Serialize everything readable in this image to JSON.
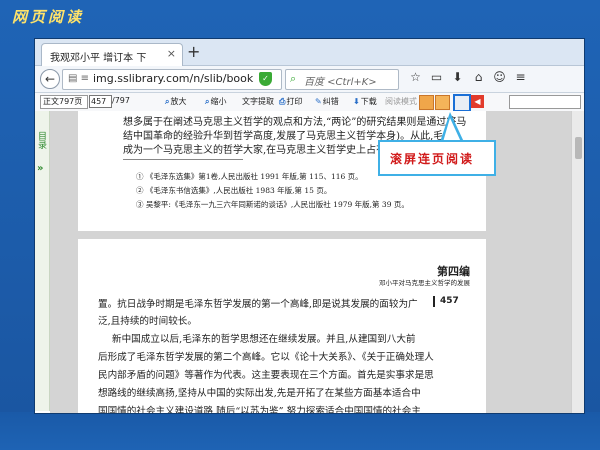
{
  "slide": {
    "title": "网页阅读",
    "colors": {
      "background": "#1f64b6",
      "title": "#ffe36a"
    }
  },
  "browser": {
    "tab_title": "我观邓小平 增订本 下",
    "tab_close_icon": "close-icon",
    "new_tab_icon": "plus-icon",
    "url": "img.sslibrary.com/n/slib/book",
    "search_placeholder": "百度 <Ctrl+K>",
    "nav_icons": [
      "star-icon",
      "reading-list-icon",
      "download-icon",
      "home-icon",
      "chat-icon",
      "menu-icon"
    ]
  },
  "reader_toolbar": {
    "page_select": "正文797页",
    "page_input": "457",
    "page_total": "/797",
    "zoom_in": "放大",
    "zoom_out": "缩小",
    "text_extract": "文字提取",
    "print": "打印",
    "correct": "纠错",
    "download": "下载",
    "reading_mode": "阅读模式"
  },
  "sidebar": {
    "tab_label": "目录",
    "expand_icon": "double-chevron-right-icon"
  },
  "page_prev": {
    "lines": [
      "想多属于在阐述马克思主义哲学的观点和方法,“两论”的研究结果则是通过将马",
      "结中国革命的经验升华到哲学高度,发展了马克思主义哲学本身)。从此,毛泽",
      "成为一个马克思主义的哲学大家,在马克思主义哲学史上占有一席之地。"
    ],
    "footnotes": [
      "①  《毛泽东选集》第1卷,人民出版社 1991 年版,第 115、116 页。",
      "②  《毛泽东书信选集》,人民出版社 1983 年版,第 15 页。",
      "③  吴黎平:《毛泽东一九三六年同斯诺的谈话》,人民出版社 1979 年版,第 39 页。"
    ]
  },
  "page_current": {
    "chapter_title": "第四编",
    "chapter_subtitle": "邓小平对马克思主义哲学的发展",
    "page_number": "457",
    "lines": [
      "置。抗日战争时期是毛泽东哲学发展的第一个高峰,即是说其发展的面较为广",
      "泛,且持续的时间较长。",
      "新中国成立以后,毛泽东的哲学思想还在继续发展。并且,从建国到八大前",
      "后形成了毛泽东哲学发展的第二个高峰。它以《论十大关系》、《关于正确处理人",
      "民内部矛盾的问题》等著作为代表。这主要表现在三个方面。首先是实事求是思",
      "想路线的继续高扬,坚持从中国的实际出发,先是开拓了在某些方面基本适合中",
      "国国情的社会主义建设道路,随后“以苏为鉴”,努力探索适合中国国情的社会主"
    ]
  },
  "callout": {
    "text": "滚屏连页阅读",
    "border_color": "#3fb0e6",
    "text_color": "#d11a1a"
  }
}
